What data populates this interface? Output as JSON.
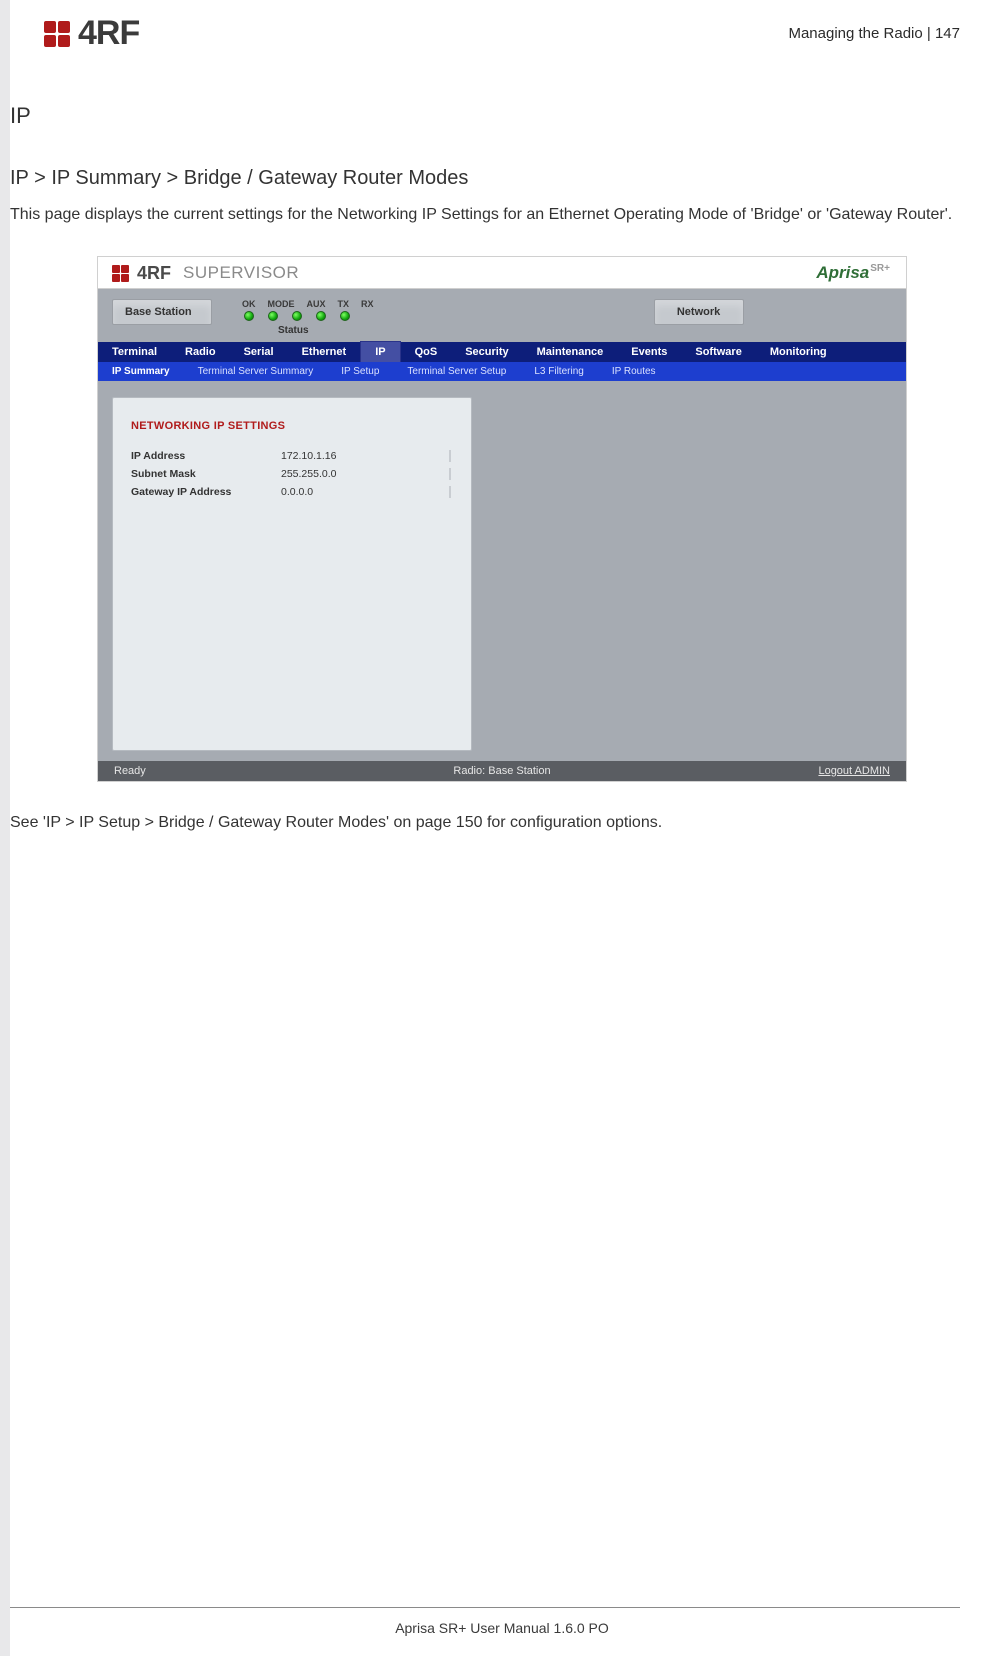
{
  "page": {
    "header_section": "Managing the Radio",
    "header_separator": "  |  ",
    "header_page_number": "147",
    "logo_text": "4RF",
    "footer_text": "Aprisa SR+ User Manual 1.6.0 PO"
  },
  "doc": {
    "h1": "IP",
    "h2": "IP > IP Summary > Bridge / Gateway Router Modes",
    "para1": "This page displays the current settings for the Networking IP Settings for an Ethernet Operating Mode of 'Bridge' or 'Gateway Router'.",
    "para2": "See 'IP > IP Setup > Bridge / Gateway Router Modes' on page 150 for configuration options."
  },
  "supervisor": {
    "brand": "4RF",
    "title_word": "SUPERVISOR",
    "brand_right": "Aprisa",
    "brand_right_suffix": "SR+",
    "status": {
      "base_station_label": "Base Station",
      "led_labels": [
        "OK",
        "MODE",
        "AUX",
        "TX",
        "RX"
      ],
      "status_caption": "Status",
      "network_label": "Network"
    },
    "tabs_primary": [
      "Terminal",
      "Radio",
      "Serial",
      "Ethernet",
      "IP",
      "QoS",
      "Security",
      "Maintenance",
      "Events",
      "Software",
      "Monitoring"
    ],
    "tabs_primary_active": "IP",
    "tabs_secondary": [
      "IP Summary",
      "Terminal Server Summary",
      "IP Setup",
      "Terminal Server Setup",
      "L3 Filtering",
      "IP Routes"
    ],
    "tabs_secondary_active": "IP Summary",
    "panel": {
      "title": "NETWORKING IP SETTINGS",
      "rows": [
        {
          "k": "IP Address",
          "v": "172.10.1.16"
        },
        {
          "k": "Subnet Mask",
          "v": "255.255.0.0"
        },
        {
          "k": "Gateway IP Address",
          "v": "0.0.0.0"
        }
      ]
    },
    "footer": {
      "left": "Ready",
      "center": "Radio: Base Station",
      "right": "Logout ADMIN"
    }
  }
}
